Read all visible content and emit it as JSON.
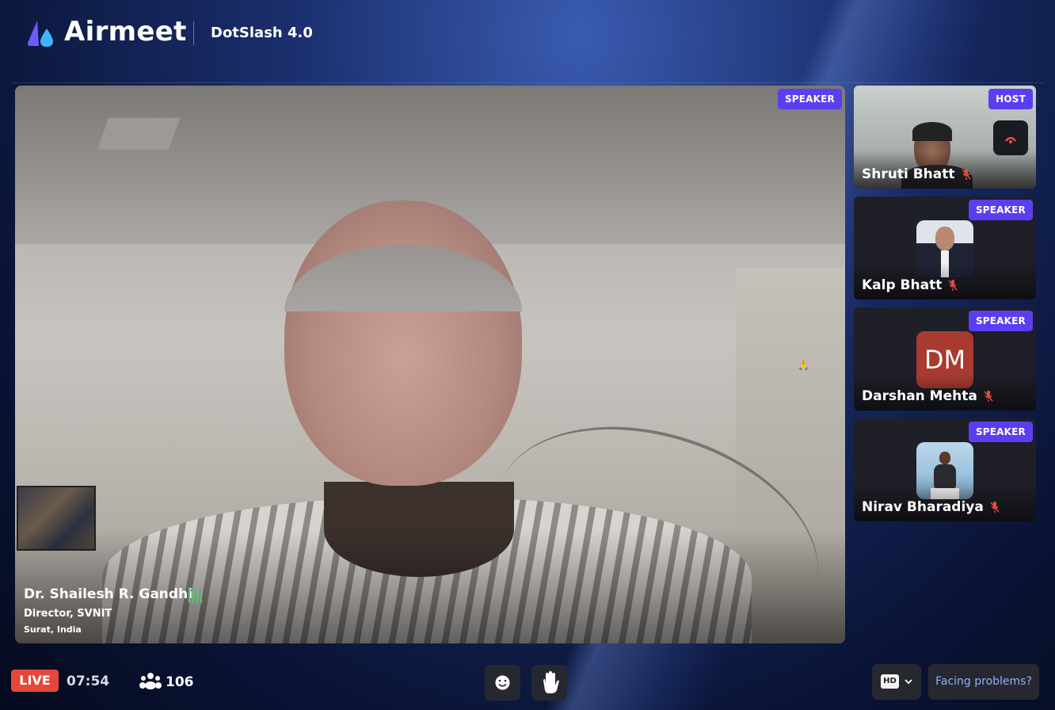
{
  "header": {
    "brand": "Airmeet",
    "event_name": "DotSlash 4.0",
    "brand_gradient": [
      "#6a5cff",
      "#3bb3ff"
    ]
  },
  "stage": {
    "role_badge": "SPEAKER",
    "speaker_name": "Dr. Shailesh R. Gandhi",
    "speaker_title": "Director, SVNIT",
    "speaker_location": "Surat, India",
    "reaction_emoji": "🙏",
    "audio_indicator_color": "#3ed45c"
  },
  "participants": [
    {
      "name": "Shruti Bhatt",
      "role": "HOST",
      "mic": "muted",
      "media": "video"
    },
    {
      "name": "Kalp Bhatt",
      "role": "SPEAKER",
      "mic": "muted",
      "media": "photo"
    },
    {
      "name": "Darshan Mehta",
      "role": "SPEAKER",
      "mic": "muted",
      "media": "initials",
      "initials": "DM",
      "initials_color": "#a83a30"
    },
    {
      "name": "Nirav Bharadiya",
      "role": "SPEAKER",
      "mic": "muted",
      "media": "photo"
    }
  ],
  "footer": {
    "live_label": "LIVE",
    "elapsed_time": "07:54",
    "attendee_count": "106",
    "hd_label": "HD",
    "help_label": "Facing problems?",
    "icons": [
      "people-icon",
      "emoji-icon",
      "raise-hand-icon",
      "chevron-down-icon"
    ],
    "accent": "#5a3ff0",
    "live_color": "#e6473b"
  }
}
